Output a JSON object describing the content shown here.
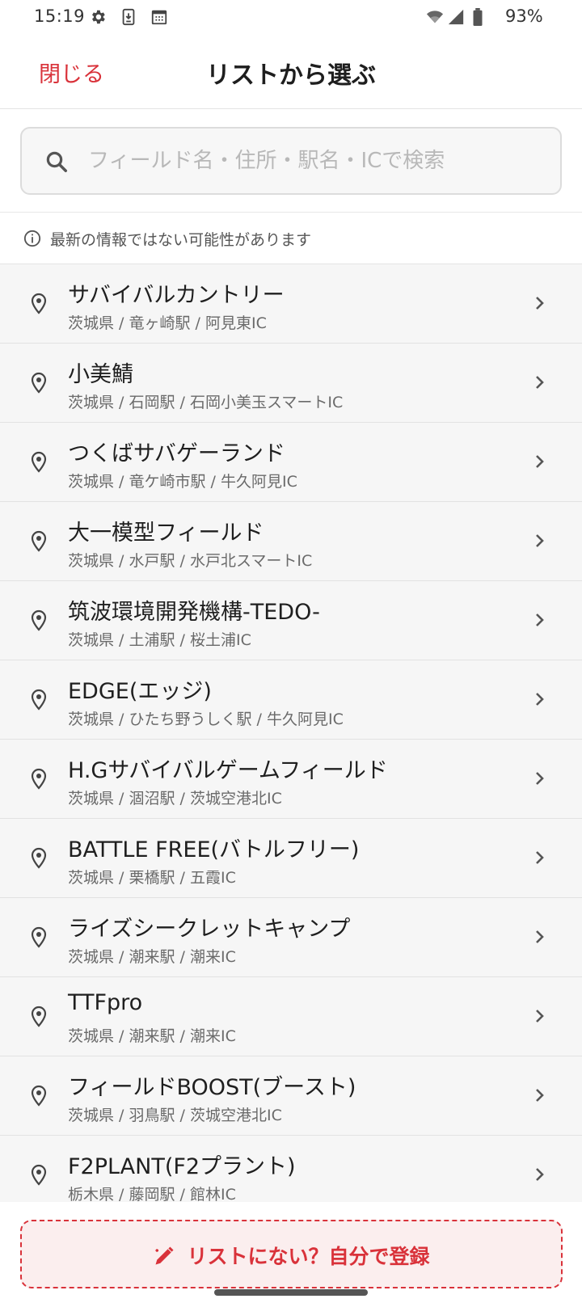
{
  "status_bar": {
    "time": "15:19",
    "battery_percent": "93%",
    "icons": [
      "gear-icon",
      "download-icon",
      "calendar-icon",
      "wifi-icon",
      "cell-signal-icon",
      "battery-icon"
    ]
  },
  "header": {
    "close_label": "閉じる",
    "title": "リストから選ぶ"
  },
  "search": {
    "placeholder": "フィールド名・住所・駅名・ICで検索",
    "value": ""
  },
  "notice": {
    "text": "最新の情報ではない可能性があります"
  },
  "fields": [
    {
      "name": "サバイバルカントリー",
      "sub": "茨城県 / 竜ヶ崎駅 / 阿見東IC"
    },
    {
      "name": "小美鯖",
      "sub": "茨城県 / 石岡駅 / 石岡小美玉スマートIC"
    },
    {
      "name": "つくばサバゲーランド",
      "sub": "茨城県 / 竜ケ崎市駅 / 牛久阿見IC"
    },
    {
      "name": "大一模型フィールド",
      "sub": "茨城県 / 水戸駅 / 水戸北スマートIC"
    },
    {
      "name": "筑波環境開発機構-TEDO-",
      "sub": "茨城県 / 土浦駅 / 桜土浦IC"
    },
    {
      "name": "EDGE(エッジ)",
      "sub": "茨城県 / ひたち野うしく駅 / 牛久阿見IC"
    },
    {
      "name": "H.Gサバイバルゲームフィールド",
      "sub": "茨城県 / 涸沼駅 / 茨城空港北IC"
    },
    {
      "name": "BATTLE FREE(バトルフリー)",
      "sub": "茨城県 / 栗橋駅 / 五霞IC"
    },
    {
      "name": "ライズシークレットキャンプ",
      "sub": "茨城県 / 潮来駅 / 潮来IC"
    },
    {
      "name": "TTFpro",
      "sub": "茨城県 / 潮来駅 / 潮来IC"
    },
    {
      "name": "フィールドBOOST(ブースト)",
      "sub": "茨城県 / 羽鳥駅 / 茨城空港北IC"
    },
    {
      "name": "F2PLANT(F2プラント)",
      "sub": "栃木県 / 藤岡駅 / 館林IC"
    }
  ],
  "footer": {
    "register_label": "リストにない？自分で登録"
  },
  "colors": {
    "accent": "#d9323a",
    "list_bg": "#f6f6f6",
    "register_bg": "#fbeeee"
  }
}
